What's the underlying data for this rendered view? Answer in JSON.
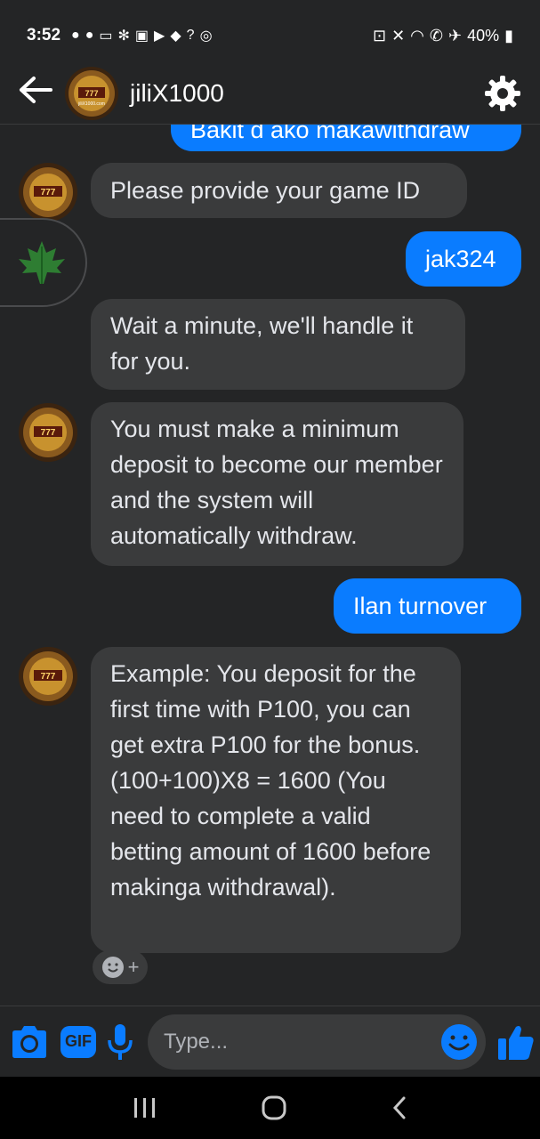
{
  "status_bar": {
    "time": "3:52",
    "battery": "40%"
  },
  "header": {
    "contact_name": "jiliX1000",
    "avatar_text": "jiliX1000.com"
  },
  "messages": [
    {
      "sender": "me",
      "text": "Bakit d ako makawithdraw"
    },
    {
      "sender": "them",
      "text": "Please provide your game ID"
    },
    {
      "sender": "me",
      "text": "jak324"
    },
    {
      "sender": "them",
      "text": "Wait a minute, we'll handle it for you."
    },
    {
      "sender": "them",
      "text": "You must make a minimum deposit to become our member and the system will automatically withdraw."
    },
    {
      "sender": "me",
      "text": "Ilan turnover"
    },
    {
      "sender": "them",
      "text": "Example: You deposit for the first time with P100, you can get extra P100 for the bonus.(100+100)X8 = 1600 (You need to complete a valid betting amount of 1600 before makinga withdrawal)."
    }
  ],
  "composer": {
    "placeholder": "Type...",
    "gif_label": "GIF"
  },
  "colors": {
    "accent": "#0a7cff",
    "incoming_bubble": "#3a3b3c",
    "background": "#242526"
  }
}
